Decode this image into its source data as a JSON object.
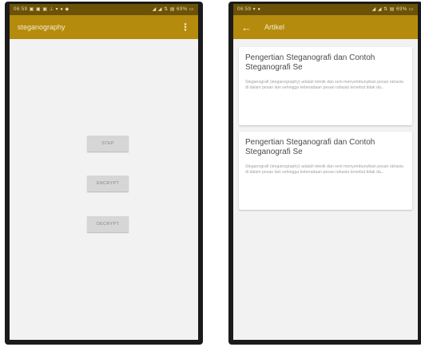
{
  "left_phone": {
    "status_left": "06:59 ▣ ▣ ▣ ⊥ ▾ ● ◆",
    "status_right": "◢ ◢ ⇅ ▤ 69% ▭",
    "app_title": "steganography",
    "menu_glyph": "⋮",
    "buttons": {
      "first": "STEP",
      "second": "ENCRYPT",
      "third": "DECRYPT"
    }
  },
  "right_phone": {
    "status_left": "06:59 ▾ ●",
    "status_right": "◢ ◢ ⇅ ▤ 69% ▭",
    "app_title": "Artikel",
    "back_glyph": "←",
    "articles": [
      {
        "title": "Pengertian Steganografi dan Contoh Steganografi Se",
        "snippet": "Steganografi (steganography) adalah teknik dan seni menyembunyikan pesan rahasia di dalam pesan lain sehingga keberadaan pesan rahasia tersebut tidak da..."
      },
      {
        "title": "Pengertian Steganografi dan Contoh Steganografi Se",
        "snippet": "Steganografi (steganography) adalah teknik dan seni menyembunyikan pesan rahasia di dalam pesan lain sehingga keberadaan pesan rahasia tersebut tidak da..."
      }
    ]
  },
  "colors": {
    "appbar": "#b58b0d",
    "statusbar": "#6b5206",
    "background": "#f2f2f2"
  }
}
